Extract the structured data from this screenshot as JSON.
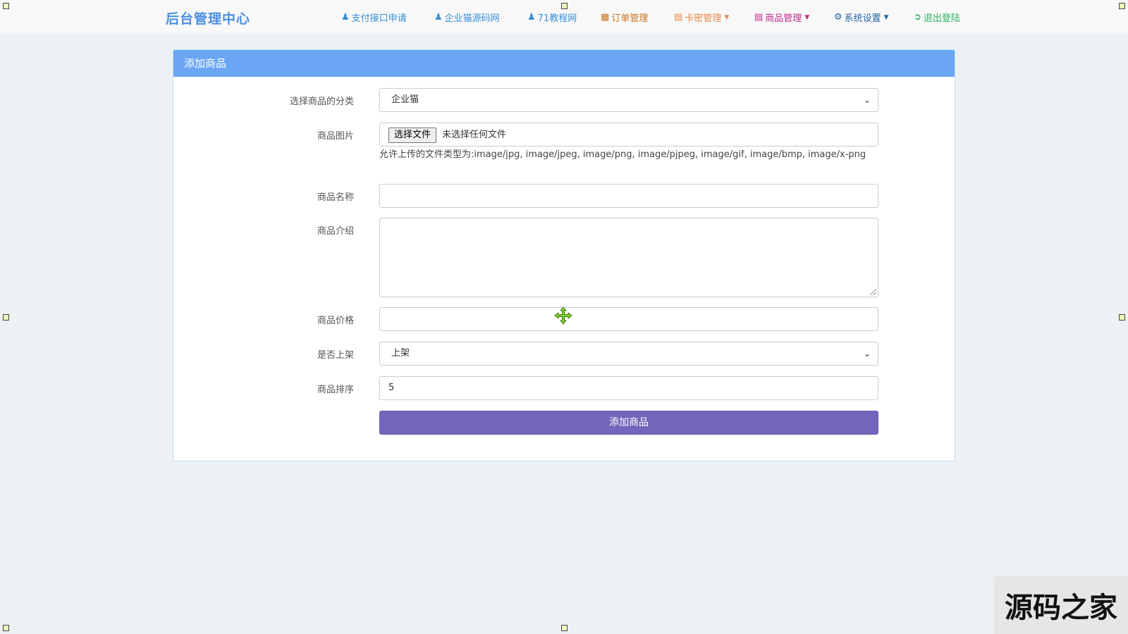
{
  "header": {
    "brand": "后台管理中心",
    "nav": [
      {
        "label": "支付接口申请",
        "icon": "user-icon",
        "color": "#3a8fd6",
        "dropdown": false
      },
      {
        "label": "企业猫源码网",
        "icon": "user-icon",
        "color": "#3a8fd6",
        "dropdown": false
      },
      {
        "label": "71教程网",
        "icon": "user-icon",
        "color": "#3a8fd6",
        "dropdown": false
      },
      {
        "label": "订单管理",
        "icon": "calculator-icon",
        "color": "#c9721f",
        "dropdown": false
      },
      {
        "label": "卡密管理",
        "icon": "list-icon",
        "color": "#e8884a",
        "dropdown": true
      },
      {
        "label": "商品管理",
        "icon": "book-icon",
        "color": "#c02a8b",
        "dropdown": true
      },
      {
        "label": "系统设置",
        "icon": "gear-icon",
        "color": "#2867a8",
        "dropdown": true
      },
      {
        "label": "退出登陆",
        "icon": "sign-out-icon",
        "color": "#2fb062",
        "dropdown": false
      }
    ]
  },
  "panel": {
    "title": "添加商品",
    "fields": {
      "category": {
        "label": "选择商品的分类",
        "value": "企业猫"
      },
      "image": {
        "label": "商品图片",
        "button": "选择文件",
        "status": "未选择任何文件",
        "hint": "允许上传的文件类型为:image/jpg, image/jpeg, image/png, image/pjpeg, image/gif, image/bmp, image/x-png"
      },
      "name": {
        "label": "商品名称",
        "value": ""
      },
      "description": {
        "label": "商品介绍",
        "value": ""
      },
      "price": {
        "label": "商品价格",
        "value": ""
      },
      "listed": {
        "label": "是否上架",
        "value": "上架"
      },
      "sort": {
        "label": "商品排序",
        "value": "5"
      }
    },
    "submit": "添加商品"
  },
  "watermark": "源码之家",
  "colors": {
    "brand": "#4a90e2",
    "panel_header": "#6aa6f4",
    "submit": "#7265bb",
    "page_bg": "#eef1f4"
  }
}
